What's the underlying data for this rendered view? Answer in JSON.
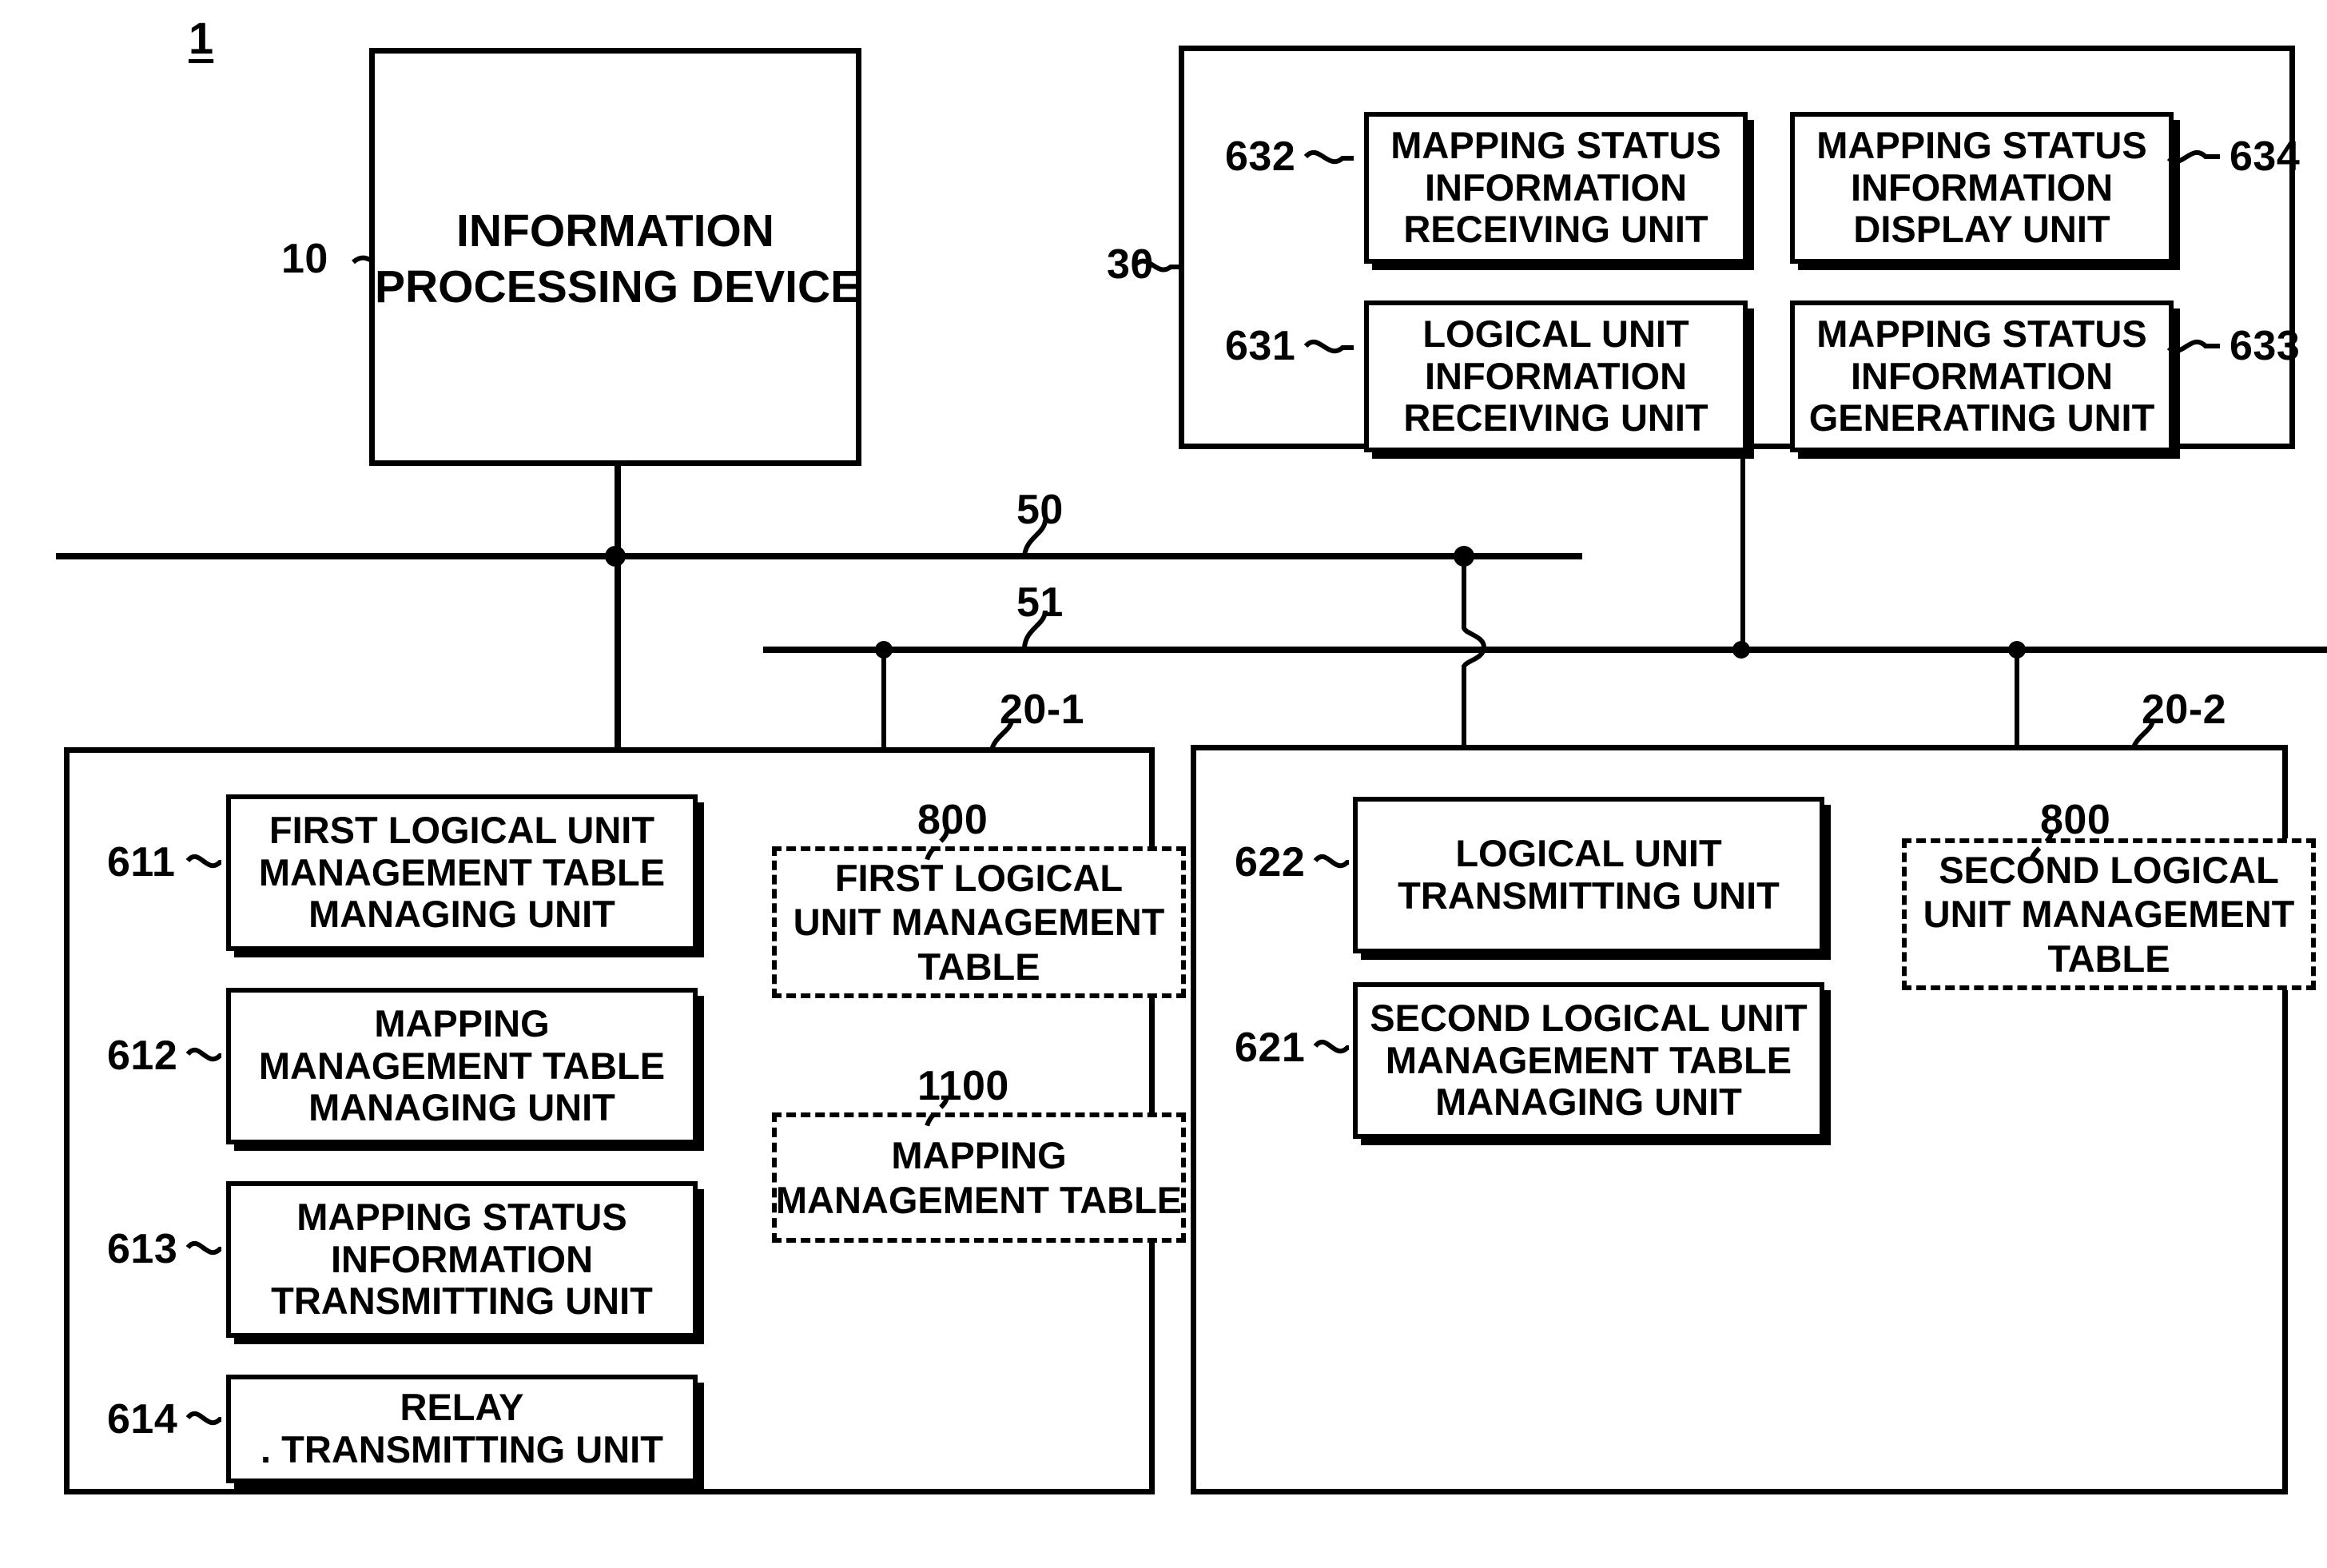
{
  "figure": {
    "number": "1"
  },
  "nodes": {
    "information_processing_device": {
      "ref": "10",
      "label": "INFORMATION\nPROCESSING DEVICE"
    },
    "management_terminal": {
      "ref": "30",
      "units": [
        {
          "ref": "632",
          "label": "MAPPING STATUS\nINFORMATION\nRECEIVING UNIT"
        },
        {
          "ref": "634",
          "label": "MAPPING STATUS\nINFORMATION\nDISPLAY UNIT"
        },
        {
          "ref": "631",
          "label": "LOGICAL UNIT\nINFORMATION\nRECEIVING UNIT"
        },
        {
          "ref": "633",
          "label": "MAPPING STATUS\nINFORMATION\nGENERATING UNIT"
        }
      ]
    },
    "storage_device_1": {
      "ref": "20-1",
      "units": [
        {
          "ref": "611",
          "label": "FIRST LOGICAL UNIT\nMANAGEMENT TABLE\nMANAGING UNIT"
        },
        {
          "ref": "612",
          "label": "MAPPING\nMANAGEMENT TABLE\nMANAGING UNIT"
        },
        {
          "ref": "613",
          "label": "MAPPING STATUS\nINFORMATION\nTRANSMITTING UNIT"
        },
        {
          "ref": "614",
          "label": "RELAY\n. TRANSMITTING UNIT"
        }
      ],
      "tables": [
        {
          "ref": "800",
          "label": "FIRST LOGICAL\nUNIT MANAGEMENT\nTABLE"
        },
        {
          "ref": "1100",
          "label": "MAPPING\nMANAGEMENT TABLE"
        }
      ]
    },
    "storage_device_2": {
      "ref": "20-2",
      "units": [
        {
          "ref": "622",
          "label": "LOGICAL UNIT\nTRANSMITTING UNIT"
        },
        {
          "ref": "621",
          "label": "SECOND LOGICAL UNIT\nMANAGEMENT TABLE\nMANAGING UNIT"
        }
      ],
      "tables": [
        {
          "ref": "800",
          "label": "SECOND LOGICAL\nUNIT MANAGEMENT\nTABLE"
        }
      ]
    }
  },
  "buses": [
    {
      "ref": "50"
    },
    {
      "ref": "51"
    }
  ],
  "colors": {
    "line": "#000000",
    "background": "#ffffff"
  }
}
